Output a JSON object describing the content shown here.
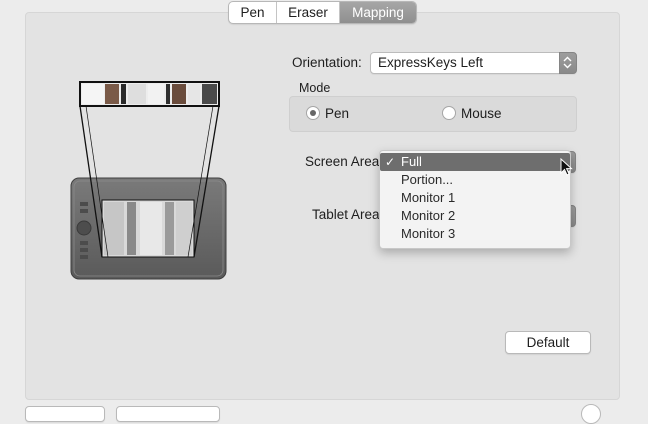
{
  "tabs": [
    "Pen",
    "Eraser",
    "Mapping"
  ],
  "active_tab": "Mapping",
  "orientation": {
    "label": "Orientation:",
    "value": "ExpressKeys Left"
  },
  "mode": {
    "label": "Mode",
    "options": [
      {
        "label": "Pen",
        "selected": true
      },
      {
        "label": "Mouse",
        "selected": false
      }
    ]
  },
  "screen_area": {
    "label": "Screen Area",
    "menu": [
      "Full",
      "Portion...",
      "Monitor 1",
      "Monitor 2",
      "Monitor 3"
    ],
    "selected": "Full",
    "check": "✓"
  },
  "tablet_area": {
    "label": "Tablet Area"
  },
  "default_button": "Default",
  "icons": [
    "tablet-illustration",
    "check-icon",
    "arrow-cursor-icon",
    "stepper-icon",
    "help-icon"
  ],
  "colors": {
    "selected_tab": "#999999",
    "menu_highlight": "#6e6e6e",
    "panel": "#e3e3e3"
  }
}
